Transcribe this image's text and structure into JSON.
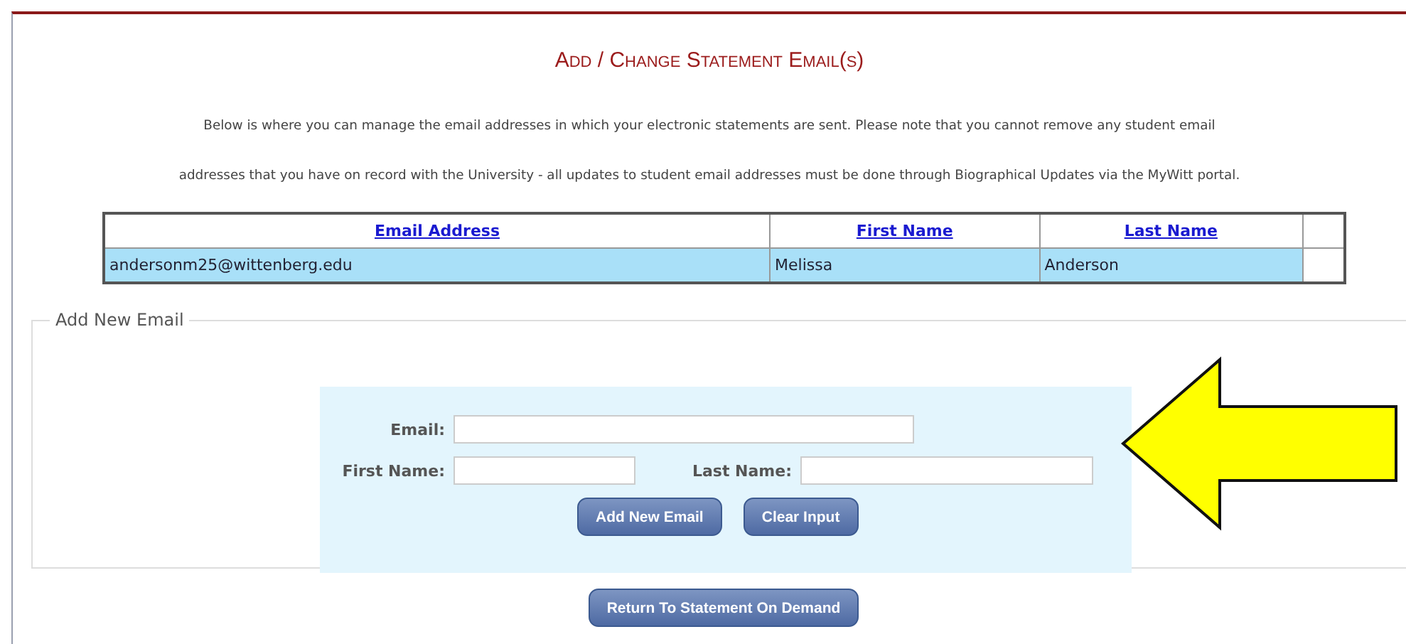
{
  "title": "Add / Change Statement Email(s)",
  "intro": [
    "Below is where you can manage the email addresses in which your electronic statements are sent.  Please note that you cannot remove any student email",
    "addresses that you have on record with the University - all updates to student email addresses must be done through Biographical Updates via the MyWitt portal."
  ],
  "table": {
    "columns": [
      "Email Address",
      "First Name",
      "Last Name"
    ],
    "rows": [
      {
        "cells": [
          "andersonm25@wittenberg.edu",
          "Melissa",
          "Anderson"
        ],
        "selected": true
      }
    ]
  },
  "add_section": {
    "legend": "Add New Email",
    "email_label": "Email:",
    "first_name_label": "First Name:",
    "last_name_label": "Last Name:",
    "buttons": [
      "Add New Email",
      "Clear Input"
    ]
  },
  "return_button": "Return To Statement On Demand"
}
